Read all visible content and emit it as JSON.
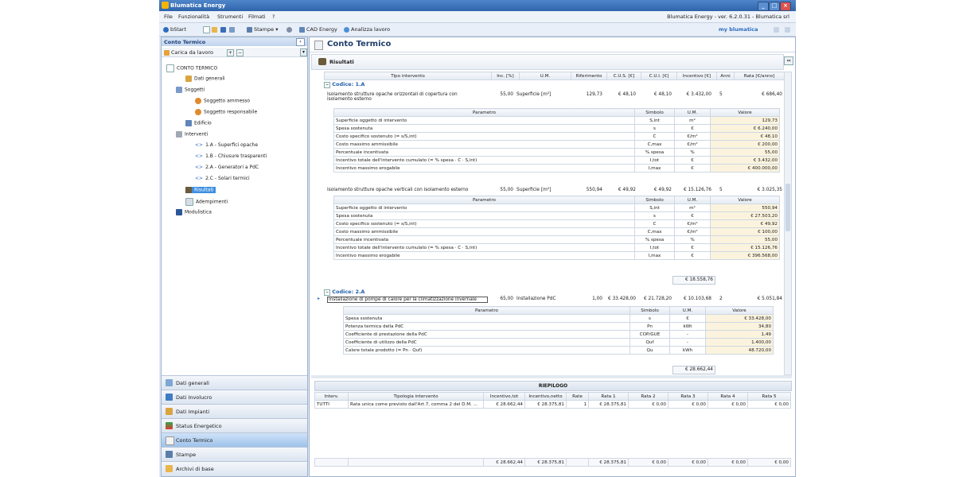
{
  "window": {
    "title": "Blumatica Energy",
    "controls": [
      "_",
      "□",
      "×"
    ]
  },
  "menu": {
    "items": [
      "File",
      "Funzionalità",
      "Strumenti",
      "Filmati",
      "?"
    ],
    "version": "Blumatica Energy - ver. 6.2.0.31 - Blumatica srl"
  },
  "toolbar": {
    "start": "bStart",
    "stampe": "Stampe",
    "cad": "CAD Energy",
    "analizza": "Analizza lavoro",
    "brand": "my blumatica"
  },
  "left": {
    "panel_title": "Conto Termico",
    "carica": "Carica da lavoro",
    "tree": {
      "root": "CONTO TERMICO",
      "dati_generali": "Dati generali",
      "soggetti": "Soggetti",
      "soggetto_ammesso": "Soggetto ammesso",
      "soggetto_responsabile": "Soggetto responsabile",
      "edificio": "Edificio",
      "interventi": "Interventi",
      "i1": "1.A - Superfici opache",
      "i2": "1.B - Chiusure trasparenti",
      "i3": "2.A - Generatori a PdC",
      "i4": "2.C - Solari termici",
      "risultati": "Risultati",
      "adempimenti": "Adempimenti",
      "modulistica": "Modulistica"
    },
    "nav": [
      "Dati generali",
      "Dati Involucro",
      "Dati Impianti",
      "Status Energetico",
      "Conto Termico",
      "Stampe",
      "Archivi di base"
    ]
  },
  "main": {
    "title": "Conto Termico",
    "subtitle": "Risultati",
    "headers": [
      "Tipo intervento",
      "Inc. [%]",
      "U.M.",
      "Riferimento",
      "C.U.S. [€]",
      "C.U.I. [€]",
      "Incentivo [€]",
      "Anni",
      "Rata [€/anno]"
    ],
    "param_headers": [
      "Parametro",
      "Simbolo",
      "U.M.",
      "Valore"
    ],
    "codice1": "Codice: 1.A",
    "codice2": "Codice: 2.A",
    "int1": {
      "tipo": "Isolamento strutture opache orizzontali di copertura con isolamento esterno",
      "inc": "55,00",
      "um": "Superficie [m²]",
      "rif": "129,73",
      "cus": "€ 48,10",
      "cui": "€ 48,10",
      "incentivo": "€ 3.432,00",
      "anni": "5",
      "rata": "€ 686,40"
    },
    "params1": [
      [
        "Superficie oggetto di intervento",
        "S,int",
        "m²",
        "129,73"
      ],
      [
        "Spesa sostenuta",
        "s",
        "€",
        "€ 6.240,00"
      ],
      [
        "Costo specifico sostenuto (= s/S,int)",
        "C",
        "€/m²",
        "€ 48,10"
      ],
      [
        "Costo massimo ammissibile",
        "C,max",
        "€/m²",
        "€ 200,00"
      ],
      [
        "Percentuale incentivata",
        "% spesa",
        "%",
        "55,00"
      ],
      [
        "Incentivo totale dell'intervento cumulato (= % spesa · C · S,int)",
        "I,tot",
        "€",
        "€ 3.432,00"
      ],
      [
        "Incentivo massimo erogabile",
        "I,max",
        "€",
        "€ 400.000,00"
      ]
    ],
    "int2": {
      "tipo": "Isolamento strutture opache verticali con isolamento esterno",
      "inc": "55,00",
      "um": "Superficie [m²]",
      "rif": "550,94",
      "cus": "€ 49,92",
      "cui": "€ 49,92",
      "incentivo": "€ 15.126,76",
      "anni": "5",
      "rata": "€ 3.025,35"
    },
    "params2": [
      [
        "Superficie oggetto di intervento",
        "S,int",
        "m²",
        "550,94"
      ],
      [
        "Spesa sostenuta",
        "s",
        "€",
        "€ 27.503,20"
      ],
      [
        "Costo specifico sostenuto (= s/S,int)",
        "C",
        "€/m²",
        "€ 49,92"
      ],
      [
        "Costo massimo ammissibile",
        "C,max",
        "€/m²",
        "€ 100,00"
      ],
      [
        "Percentuale incentivata",
        "% spesa",
        "%",
        "55,00"
      ],
      [
        "Incentivo totale dell'intervento cumulato (= % spesa · C · S,int)",
        "I,tot",
        "€",
        "€ 15.126,76"
      ],
      [
        "Incentivo massimo erogabile",
        "I,max",
        "€",
        "€ 396.568,00"
      ]
    ],
    "tot1": "€ 18.558,76",
    "int3": {
      "tipo": "Installazione di pompe di calore per la climatizzazione invernale",
      "inc": "65,00",
      "um": "Installazione PdC",
      "rif": "1,00",
      "cus": "€ 33.428,00",
      "cui": "€ 21.728,20",
      "incentivo": "€ 10.103,68",
      "anni": "2",
      "rata": "€ 5.051,84"
    },
    "params3": [
      [
        "Spesa sostenuta",
        "s",
        "€",
        "€ 33.428,00"
      ],
      [
        "Potenza termica della PdC",
        "Pn",
        "kWt",
        "34,80"
      ],
      [
        "Coefficiente di prestazione della PdC",
        "COP/GUE",
        "-",
        "1,49"
      ],
      [
        "Coefficiente di utilizzo della PdC",
        "Quf",
        "-",
        "1.400,00"
      ],
      [
        "Calore totale prodotto (= Pn · Quf)",
        "Qu",
        "kWh",
        "48.720,00"
      ]
    ],
    "tot2": "€ 28.662,44",
    "riepilogo": {
      "title": "RIEPILOGO",
      "headers": [
        "Interv.",
        "Tipologia intervento",
        "Incentivo,tot",
        "Incentivo,netto",
        "Rate",
        "Rata 1",
        "Rata 2",
        "Rata 3",
        "Rata 4",
        "Rata 5"
      ],
      "row": [
        "TUTTI",
        "Rata unica come previsto dall'Art.7, comma 2 del D.M. ...",
        "€ 28.662,44",
        "€ 28.375,81",
        "1",
        "€ 28.375,81",
        "€ 0,00",
        "€ 0,00",
        "€ 0,00",
        "€ 0,00"
      ],
      "totals": [
        "€ 28.662,44",
        "€ 28.375,81",
        "€ 28.375,81",
        "€ 0,00",
        "€ 0,00",
        "€ 0,00",
        "€ 0,00"
      ]
    }
  }
}
